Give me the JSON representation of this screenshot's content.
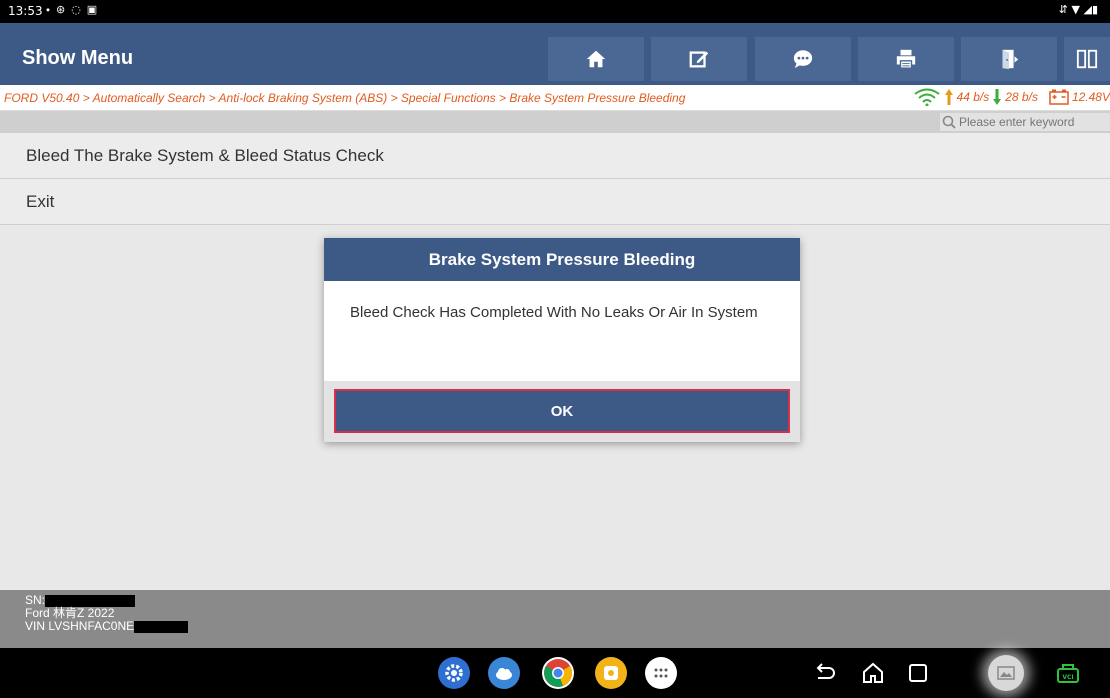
{
  "status_bar": {
    "time": "13:53",
    "left_icons": [
      "location-icon",
      "settings-icon",
      "message-icon",
      "sim-icon"
    ],
    "right_icons": [
      "signal-icon",
      "wifi-icon",
      "battery-icon"
    ]
  },
  "app_bar": {
    "title": "Show Menu",
    "buttons": [
      "home-icon",
      "edit-icon",
      "chat-icon",
      "print-icon",
      "exit-icon",
      "window-icon"
    ]
  },
  "breadcrumb": {
    "path": "FORD V50.40 > Automatically Search > Anti-lock Braking System (ABS) > Special Functions > Brake System Pressure Bleeding",
    "upload_rate": "44 b/s",
    "download_rate": "28 b/s",
    "battery_voltage": "12.48V"
  },
  "search": {
    "placeholder": "Please enter keyword"
  },
  "menu": {
    "items": [
      {
        "label": "Bleed The Brake System & Bleed Status Check"
      },
      {
        "label": "Exit"
      }
    ]
  },
  "footer": {
    "sn_label": "SN:",
    "vehicle": "Ford 林肯Z 2022",
    "vin_label": "VIN LVSHNFAC0NE"
  },
  "dialog": {
    "title": "Brake System Pressure Bleeding",
    "message": "Bleed Check Has Completed With No Leaks Or Air In System",
    "ok_label": "OK"
  },
  "colors": {
    "primary": "#3d5a86",
    "breadcrumb_text": "#e25b1f",
    "menu_bg": "#e8e8e8",
    "focus_border": "#d6304c"
  }
}
